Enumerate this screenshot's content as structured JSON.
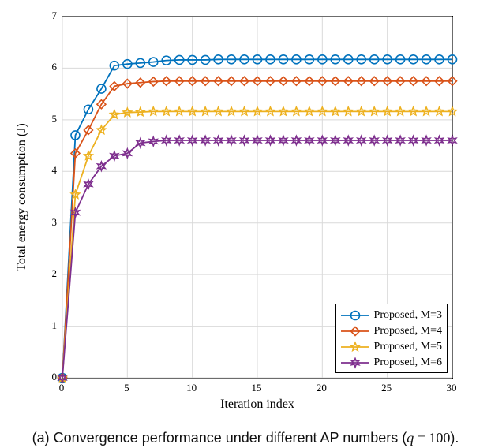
{
  "chart_data": {
    "type": "line",
    "title": "",
    "xlabel": "Iteration index",
    "ylabel": "Total energy consumption (J)",
    "xlim": [
      0,
      30
    ],
    "ylim": [
      0,
      7
    ],
    "xticks": [
      0,
      5,
      10,
      15,
      20,
      25,
      30
    ],
    "yticks": [
      0,
      1,
      2,
      3,
      4,
      5,
      6,
      7
    ],
    "x": [
      0,
      1,
      2,
      3,
      4,
      5,
      6,
      7,
      8,
      9,
      10,
      11,
      12,
      13,
      14,
      15,
      16,
      17,
      18,
      19,
      20,
      21,
      22,
      23,
      24,
      25,
      26,
      27,
      28,
      29,
      30
    ],
    "series": [
      {
        "name": "Proposed, M=3",
        "color": "#0072BD",
        "marker": "circle",
        "values": [
          0,
          4.7,
          5.2,
          5.6,
          6.05,
          6.08,
          6.1,
          6.12,
          6.15,
          6.16,
          6.16,
          6.16,
          6.17,
          6.17,
          6.17,
          6.17,
          6.17,
          6.17,
          6.17,
          6.17,
          6.17,
          6.17,
          6.17,
          6.17,
          6.17,
          6.17,
          6.17,
          6.17,
          6.17,
          6.17,
          6.17
        ]
      },
      {
        "name": "Proposed, M=4",
        "color": "#D95319",
        "marker": "diamond",
        "values": [
          0,
          4.35,
          4.8,
          5.3,
          5.65,
          5.7,
          5.72,
          5.74,
          5.75,
          5.75,
          5.75,
          5.75,
          5.75,
          5.75,
          5.75,
          5.75,
          5.75,
          5.75,
          5.75,
          5.75,
          5.75,
          5.75,
          5.75,
          5.75,
          5.75,
          5.75,
          5.75,
          5.75,
          5.75,
          5.75,
          5.75
        ]
      },
      {
        "name": "Proposed, M=5",
        "color": "#EDB120",
        "marker": "star5",
        "values": [
          0,
          3.55,
          4.3,
          4.8,
          5.1,
          5.14,
          5.15,
          5.16,
          5.16,
          5.16,
          5.16,
          5.16,
          5.16,
          5.16,
          5.16,
          5.16,
          5.16,
          5.16,
          5.16,
          5.16,
          5.16,
          5.16,
          5.16,
          5.16,
          5.16,
          5.16,
          5.16,
          5.16,
          5.16,
          5.16,
          5.16
        ]
      },
      {
        "name": "Proposed, M=6",
        "color": "#7E2F8E",
        "marker": "star6",
        "values": [
          0,
          3.2,
          3.75,
          4.1,
          4.3,
          4.35,
          4.55,
          4.58,
          4.6,
          4.6,
          4.6,
          4.6,
          4.6,
          4.6,
          4.6,
          4.6,
          4.6,
          4.6,
          4.6,
          4.6,
          4.6,
          4.6,
          4.6,
          4.6,
          4.6,
          4.6,
          4.6,
          4.6,
          4.6,
          4.6,
          4.6
        ]
      }
    ],
    "legend_position": "bottom-right"
  },
  "caption": {
    "prefix": "(a) Convergence performance under different AP numbers (",
    "var": "q",
    "eq": " = 100",
    "suffix": ")."
  }
}
